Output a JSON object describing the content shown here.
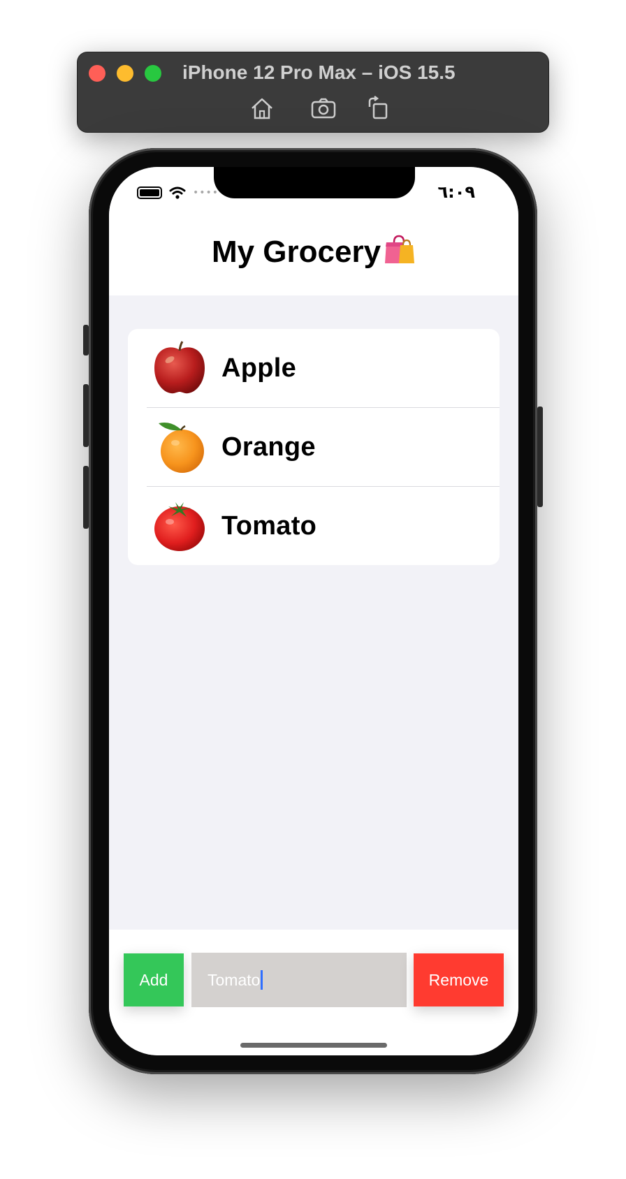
{
  "simulator": {
    "title": "iPhone 12 Pro Max – iOS 15.5",
    "toolbar": [
      {
        "icon": "home-icon"
      },
      {
        "icon": "camera-icon"
      },
      {
        "icon": "rotate-icon"
      }
    ]
  },
  "status_bar": {
    "time": "٦:٠٩",
    "dots": "••••",
    "icons": [
      "battery-icon",
      "wifi-icon"
    ]
  },
  "header": {
    "title": "My Grocery",
    "title_icon": "shopping-bags-icon"
  },
  "grocery_list": {
    "items": [
      {
        "label": "Apple",
        "icon": "apple-icon"
      },
      {
        "label": "Orange",
        "icon": "orange-icon"
      },
      {
        "label": "Tomato",
        "icon": "tomato-icon"
      }
    ]
  },
  "controls": {
    "add_label": "Add",
    "remove_label": "Remove",
    "input_value": "Tomato"
  },
  "colors": {
    "add": "#34c759",
    "remove": "#ff3b30",
    "input_bg": "#d4d1cf",
    "list_bg": "#f2f2f7"
  }
}
